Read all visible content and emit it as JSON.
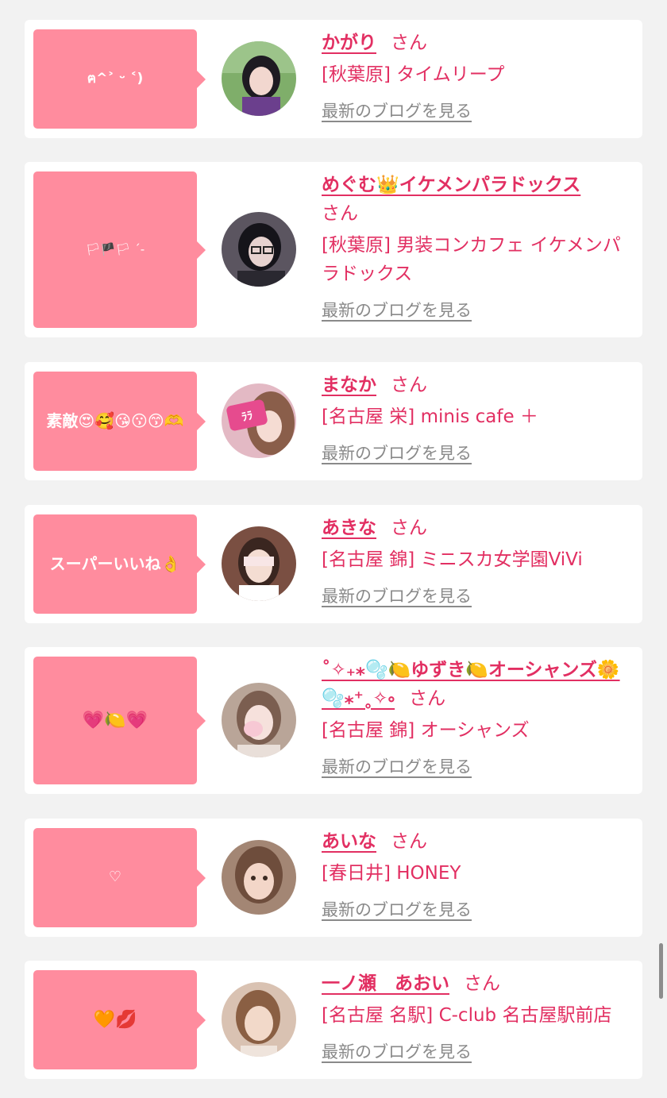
{
  "cards": [
    {
      "reaction": "ฅ^˃ ᵕ ˂)",
      "reaction_icon": "",
      "name": "かがり",
      "san": "さん",
      "shop": "[秋葉原] タイムリープ",
      "blog_link": "最新のブログを見る",
      "avatar_colors": [
        "#6aa84f",
        "#4a3a5c"
      ]
    },
    {
      "reaction": "🏳🏴🏳 ˊ-",
      "reaction_icon": "",
      "name": "めぐむ👑イケメンパラドックス",
      "san": "さん",
      "shop": "[秋葉原] 男装コンカフェ イケメンパラドックス",
      "blog_link": "最新のブログを見る",
      "avatar_colors": [
        "#3a3a4a",
        "#8a7a70"
      ]
    },
    {
      "reaction": "素敵😍🥰😘😗😙🫶",
      "reaction_icon": "",
      "name": "まなか",
      "san": "さん",
      "shop": "[名古屋 栄] minis cafe ＋",
      "blog_link": "最新のブログを見る",
      "avatar_colors": [
        "#e98aa8",
        "#c9a27d"
      ]
    },
    {
      "reaction": "スーパーいいね👌",
      "reaction_icon": "",
      "name": "あきな",
      "san": "さん",
      "shop": "[名古屋 錦] ミニスカ女学園ViVi",
      "blog_link": "最新のブログを見る",
      "avatar_colors": [
        "#c98f86",
        "#f3d6cf"
      ]
    },
    {
      "reaction": "💗🍋💗",
      "reaction_icon": "",
      "name": "˚✧₊⁎🫧🍋ゆずき🍋オーシャンズ🌼🫧⁎⁺˳✧༚",
      "san": "さん",
      "shop": "[名古屋 錦] オーシャンズ",
      "blog_link": "最新のブログを見る",
      "avatar_colors": [
        "#c7b3a5",
        "#f4d2d8"
      ]
    },
    {
      "reaction": "♡",
      "reaction_icon": "",
      "name": "あいな",
      "san": "さん",
      "shop": "[春日井] HONEY",
      "blog_link": "最新のブログを見る",
      "avatar_colors": [
        "#b4927b",
        "#eed3c5"
      ]
    },
    {
      "reaction": "🧡💋",
      "reaction_icon": "",
      "name": "一ノ瀬　あおい",
      "san": "さん",
      "shop": "[名古屋 名駅] C-club 名古屋駅前店",
      "blog_link": "最新のブログを見る",
      "avatar_colors": [
        "#b88c6a",
        "#f0d7c5"
      ]
    }
  ],
  "colors": {
    "bubble": "#ff8c9e",
    "accent": "#e22f62",
    "link_gray": "#8a8a8a",
    "background": "#f2f2f2"
  }
}
